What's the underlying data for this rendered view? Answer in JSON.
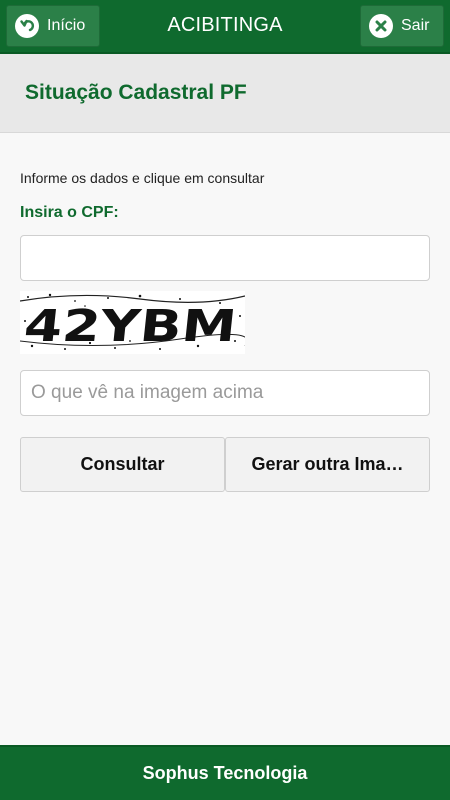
{
  "header": {
    "back_label": "Início",
    "app_title": "ACIBITINGA",
    "exit_label": "Sair"
  },
  "page": {
    "title": "Situação Cadastral PF"
  },
  "form": {
    "instructions": "Informe os dados e clique em consultar",
    "cpf_label": "Insira o CPF:",
    "cpf_value": "",
    "captcha_text": "42YBM",
    "captcha_placeholder": "O que vê na imagem acima",
    "submit_label": "Consultar",
    "regenerate_label": "Gerar outra Ima…"
  },
  "footer": {
    "text": "Sophus Tecnologia"
  },
  "colors": {
    "brand_green": "#0f6a2e",
    "button_green": "#2b8048"
  },
  "icons": {
    "back": "back-arrow-icon",
    "exit": "close-x-icon"
  }
}
